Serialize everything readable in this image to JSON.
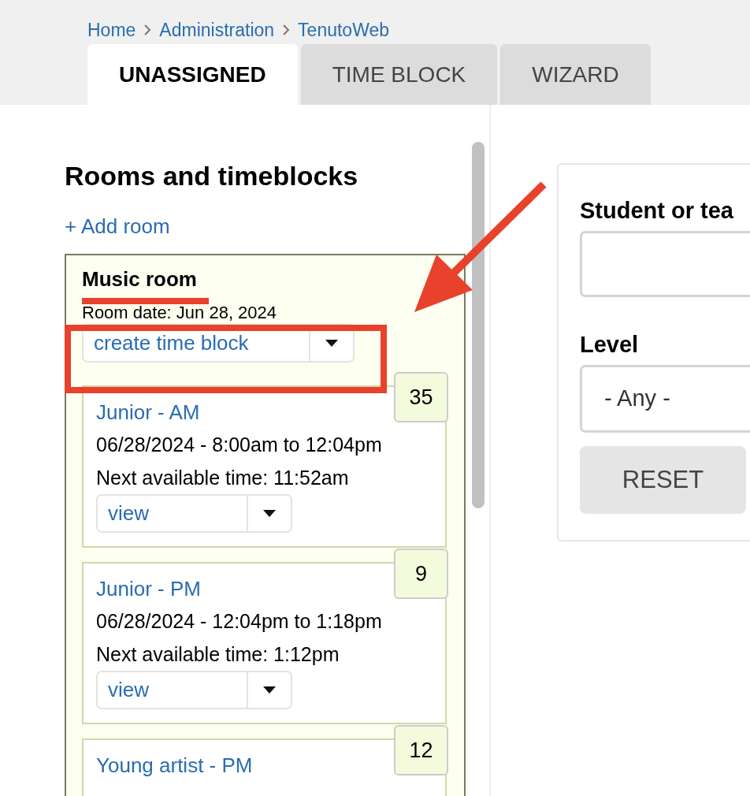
{
  "breadcrumb": [
    "Home",
    "Administration",
    "TenutoWeb"
  ],
  "tabs": [
    {
      "label": "UNASSIGNED",
      "selected": true
    },
    {
      "label": "TIME BLOCK",
      "selected": false
    },
    {
      "label": "WIZARD",
      "selected": false
    }
  ],
  "left": {
    "heading": "Rooms and timeblocks",
    "add_link": "+ Add room",
    "room": {
      "name": "Music room",
      "date": "Room date: Jun 28, 2024",
      "action": "create time block",
      "blocks": [
        {
          "title": "Junior - AM",
          "range": "06/28/2024 - 8:00am to 12:04pm",
          "next": "Next available time: 11:52am",
          "action": "view",
          "count": "35"
        },
        {
          "title": "Junior - PM",
          "range": "06/28/2024 - 12:04pm to 1:18pm",
          "next": "Next available time: 1:12pm",
          "action": "view",
          "count": "9"
        },
        {
          "title": "Young artist - PM",
          "count": "12"
        }
      ]
    }
  },
  "filters": {
    "search_label": "Student or tea",
    "level_label": "Level",
    "level_value": "- Any -",
    "reset": "RESET"
  },
  "annotations": [
    {
      "kind": "underline"
    },
    {
      "kind": "box"
    },
    {
      "kind": "arrow"
    }
  ]
}
